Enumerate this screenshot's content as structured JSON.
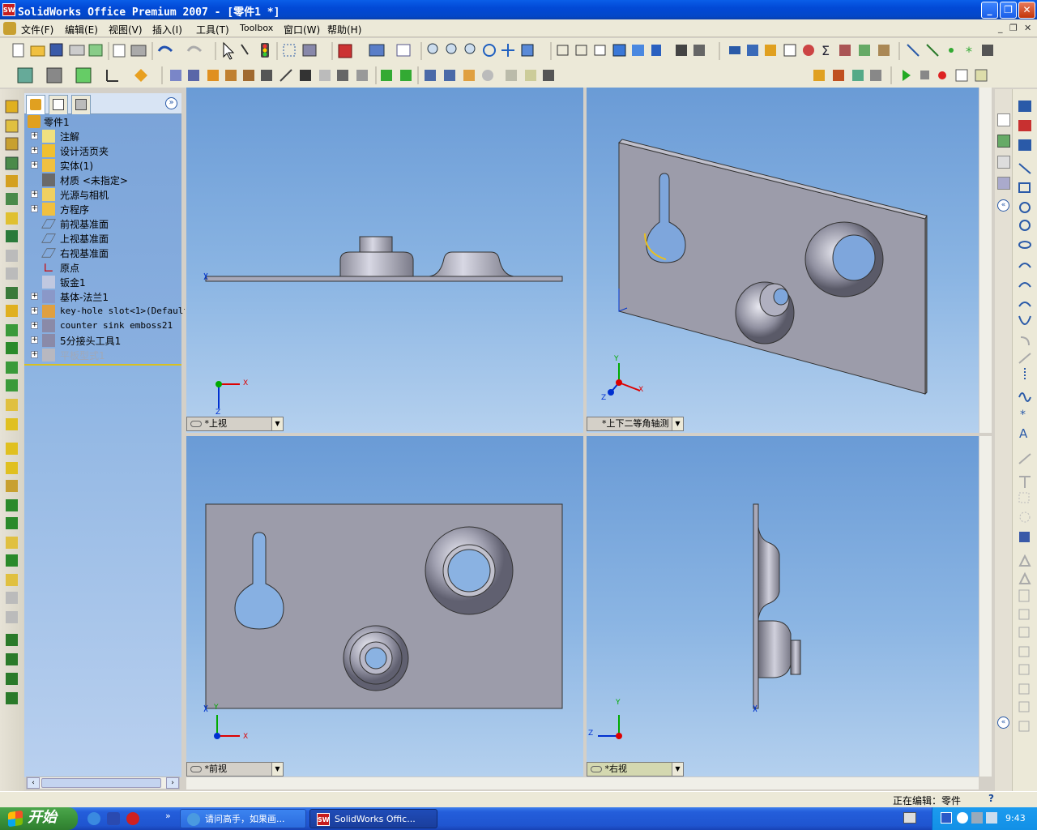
{
  "window": {
    "title": "SolidWorks Office Premium 2007 - [零件1 *]",
    "logo_text": "SW",
    "minimize": "_",
    "maximize": "❐",
    "close": "✕"
  },
  "menu": {
    "items": [
      "文件(F)",
      "编辑(E)",
      "视图(V)",
      "插入(I)",
      "工具(T)",
      "Toolbox",
      "窗口(W)",
      "帮助(H)"
    ],
    "doc_controls": [
      "_",
      "❐",
      "✕"
    ]
  },
  "feature_tree": {
    "root": "零件1",
    "items": [
      {
        "label": "注解",
        "expandable": true,
        "icon": "annotation-icon"
      },
      {
        "label": "设计活页夹",
        "expandable": true,
        "icon": "design-binder-icon"
      },
      {
        "label": "实体(1)",
        "expandable": true,
        "icon": "solid-bodies-icon"
      },
      {
        "label": "材质 <未指定>",
        "expandable": false,
        "icon": "material-icon"
      },
      {
        "label": "光源与相机",
        "expandable": true,
        "icon": "lights-camera-icon"
      },
      {
        "label": "方程序",
        "expandable": true,
        "icon": "equations-icon"
      },
      {
        "label": "前视基准面",
        "expandable": false,
        "icon": "plane-icon"
      },
      {
        "label": "上视基准面",
        "expandable": false,
        "icon": "plane-icon"
      },
      {
        "label": "右视基准面",
        "expandable": false,
        "icon": "plane-icon"
      },
      {
        "label": "原点",
        "expandable": false,
        "icon": "origin-icon"
      },
      {
        "label": "钣金1",
        "expandable": false,
        "icon": "sheet-metal-icon"
      },
      {
        "label": "基体-法兰1",
        "expandable": true,
        "icon": "base-flange-icon"
      },
      {
        "label": "key-hole slot<1>(Default)",
        "expandable": true,
        "icon": "library-feature-icon",
        "mono": true
      },
      {
        "label": "counter sink emboss21",
        "expandable": true,
        "icon": "forming-tool-icon",
        "mono": true
      },
      {
        "label": "5分接头工具1",
        "expandable": true,
        "icon": "forming-tool-icon"
      },
      {
        "label": "平板型式1",
        "expandable": true,
        "icon": "flat-pattern-icon",
        "grayed": true
      }
    ]
  },
  "viewports": [
    {
      "id": "top",
      "label": "*上视"
    },
    {
      "id": "iso",
      "label": "*上下二等角轴测"
    },
    {
      "id": "front",
      "label": "*前视"
    },
    {
      "id": "right",
      "label": "*右视"
    }
  ],
  "axes": {
    "x": "X",
    "y": "Y",
    "z": "Z"
  },
  "status": {
    "text": "正在编辑：零件",
    "help": "?"
  },
  "taskbar": {
    "start": "开始",
    "tasks": [
      "请问高手，如果画...",
      "SolidWorks Offic..."
    ],
    "clock": "9:43",
    "more": "»"
  },
  "colors": {
    "accent": "#0a5ee8",
    "tree_bg": "#7aa3d8",
    "start_green": "#3b933b"
  }
}
